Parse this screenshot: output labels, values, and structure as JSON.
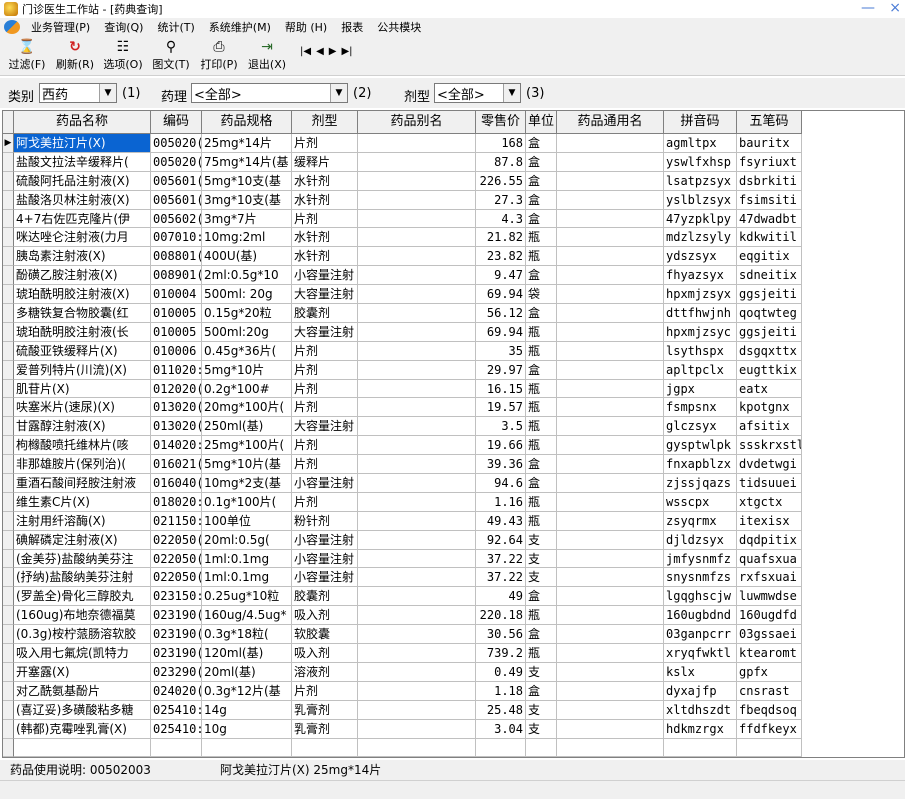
{
  "window": {
    "title": "门诊医生工作站 - [药典查询]",
    "minimize": "—",
    "close": "×"
  },
  "menu": [
    "业务管理(P)",
    "查询(Q)",
    "统计(T)",
    "系统维护(M)",
    "帮助 (H)",
    "报表",
    "公共模块"
  ],
  "toolbar": [
    {
      "label": "过滤(F)",
      "icon": "funnel-icon",
      "glyph": "⌛"
    },
    {
      "label": "刷新(R)",
      "icon": "refresh-icon",
      "glyph": "↻"
    },
    {
      "label": "选项(O)",
      "icon": "options-icon",
      "glyph": "☷"
    },
    {
      "label": "图文(T)",
      "icon": "search-icon",
      "glyph": "⚲"
    },
    {
      "label": "打印(P)",
      "icon": "printer-icon",
      "glyph": "⎙"
    },
    {
      "label": "退出(X)",
      "icon": "exit-icon",
      "glyph": "⇥"
    }
  ],
  "nav": [
    "|◀",
    "◀",
    "▶",
    "▶|"
  ],
  "filters": {
    "category_label": "类别",
    "category_value": "西药",
    "category_hint": "(1)",
    "pharmacology_label": "药理",
    "pharmacology_value": "<全部>",
    "pharmacology_hint": "(2)",
    "dosage_label": "剂型",
    "dosage_value": "<全部>",
    "dosage_hint": "(3)"
  },
  "columns": [
    "药品名称",
    "编码",
    "药品规格",
    "剂型",
    "药品别名",
    "零售价",
    "单位",
    "药品通用名",
    "拼音码",
    "五笔码"
  ],
  "rows": [
    [
      "阿戈美拉汀片(X)",
      "005020(",
      "25mg*14片",
      "片剂",
      "",
      "168",
      "盒",
      "",
      "agmltpx",
      "bauritx"
    ],
    [
      "盐酸文拉法辛缓释片(",
      "005020(",
      "75mg*14片(基",
      "缓释片",
      "",
      "87.8",
      "盒",
      "",
      "yswlfxhsp",
      "fsyriuxt"
    ],
    [
      "硫酸阿托品注射液(X)",
      "005601(",
      "5mg*10支(基",
      "水针剂",
      "",
      "226.55",
      "盒",
      "",
      "lsatpzsyx",
      "dsbrkiti"
    ],
    [
      "盐酸洛贝林注射液(X)",
      "005601(",
      "3mg*10支(基",
      "水针剂",
      "",
      "27.3",
      "盒",
      "",
      "yslblzsyx",
      "fsimsiti"
    ],
    [
      "4+7右佐匹克隆片(伊",
      "005602(",
      "3mg*7片",
      "片剂",
      "",
      "4.3",
      "盒",
      "",
      "47yzpklpy",
      "47dwadbt"
    ],
    [
      "咪达唑仑注射液(力月",
      "007010:",
      "10mg:2ml",
      "水针剂",
      "",
      "21.82",
      "瓶",
      "",
      "mdzlzsyly",
      "kdkwitil"
    ],
    [
      "胰岛素注射液(X)",
      "008801(",
      "400U(基)",
      "水针剂",
      "",
      "23.82",
      "瓶",
      "",
      "ydszsyx",
      "eqgitix"
    ],
    [
      "酚磺乙胺注射液(X)",
      "008901(",
      "2ml:0.5g*10",
      "小容量注射",
      "",
      "9.47",
      "盒",
      "",
      "fhyazsyx",
      "sdneitix"
    ],
    [
      "琥珀酰明胶注射液(X)",
      "010004",
      "500ml: 20g",
      "大容量注射",
      "",
      "69.94",
      "袋",
      "",
      "hpxmjzsyx",
      "ggsjeiti"
    ],
    [
      "多糖铁复合物胶囊(红",
      "010005",
      "0.15g*20粒",
      "胶囊剂",
      "",
      "56.12",
      "盒",
      "",
      "dttfhwjnh",
      "qoqtwteg"
    ],
    [
      "琥珀酰明胶注射液(长",
      "010005",
      "500ml:20g",
      "大容量注射",
      "",
      "69.94",
      "瓶",
      "",
      "hpxmjzsyc",
      "ggsjeiti"
    ],
    [
      "硫酸亚铁缓释片(X)",
      "010006",
      "0.45g*36片(",
      "片剂",
      "",
      "35",
      "瓶",
      "",
      "lsythspx",
      "dsgqxttx"
    ],
    [
      "爱普列特片(川流)(X)",
      "011020:",
      "5mg*10片",
      "片剂",
      "",
      "29.97",
      "盒",
      "",
      "apltpclx",
      "eugttkix"
    ],
    [
      "肌苷片(X)",
      "012020(",
      "0.2g*100#",
      "片剂",
      "",
      "16.15",
      "瓶",
      "",
      "jgpx",
      "eatx"
    ],
    [
      "呋塞米片(速尿)(X)",
      "013020(",
      "20mg*100片(",
      "片剂",
      "",
      "19.57",
      "瓶",
      "",
      "fsmpsnx",
      "kpotgnx"
    ],
    [
      "甘露醇注射液(X)",
      "013020(",
      "250ml(基)",
      "大容量注射",
      "",
      "3.5",
      "瓶",
      "",
      "glczsyx",
      "afsitix"
    ],
    [
      "枸橼酸喷托维林片(咳",
      "014020:",
      "25mg*100片(",
      "片剂",
      "",
      "19.66",
      "瓶",
      "",
      "gysptwlpk",
      "ssskrxstl"
    ],
    [
      "非那雄胺片(保列治)(",
      "016021(",
      "5mg*10片(基",
      "片剂",
      "",
      "39.36",
      "盒",
      "",
      "fnxapblzx",
      "dvdetwgi"
    ],
    [
      "重酒石酸间羟胺注射液",
      "016040(",
      "10mg*2支(基",
      "小容量注射",
      "",
      "94.6",
      "盒",
      "",
      "zjssjqazs",
      "tidsuuei"
    ],
    [
      "维生素C片(X)",
      "018020:",
      "0.1g*100片(",
      "片剂",
      "",
      "1.16",
      "瓶",
      "",
      "wsscpx",
      "xtgctx"
    ],
    [
      "注射用纤溶酶(X)",
      "021150:",
      "100单位",
      "粉针剂",
      "",
      "49.43",
      "瓶",
      "",
      "zsyqrmx",
      "itexisx"
    ],
    [
      "碘解磷定注射液(X)",
      "022050(",
      "20ml:0.5g(",
      "小容量注射",
      "",
      "92.64",
      "支",
      "",
      "djldzsyx",
      "dqdpitix"
    ],
    [
      "(金美芬)盐酸纳美芬注",
      "022050(",
      "1ml:0.1mg",
      "小容量注射",
      "",
      "37.22",
      "支",
      "",
      "jmfysnmfz",
      "quafsxua"
    ],
    [
      "(抒纳)盐酸纳美芬注射",
      "022050(",
      "1ml:0.1mg",
      "小容量注射",
      "",
      "37.22",
      "支",
      "",
      "snysnmfzs",
      "rxfsxuai"
    ],
    [
      "(罗盖全)骨化三醇胶丸",
      "023150:",
      "0.25ug*10粒",
      "胶囊剂",
      "",
      "49",
      "盒",
      "",
      "lgqghscjw",
      "luwmwdse"
    ],
    [
      "(160ug)布地奈德福莫",
      "023190(",
      "160ug/4.5ug*",
      "吸入剂",
      "",
      "220.18",
      "瓶",
      "",
      "160ugbdnd",
      "160ugdfd"
    ],
    [
      "(0.3g)桉柠蒎肠溶软胶",
      "023190(",
      "0.3g*18粒(",
      "软胶囊",
      "",
      "30.56",
      "盒",
      "",
      "03ganpcrr",
      "03gssaei"
    ],
    [
      "吸入用七氟烷(凯特力",
      "023190(",
      "120ml(基)",
      "吸入剂",
      "",
      "739.2",
      "瓶",
      "",
      "xryqfwktl",
      "ktearomt"
    ],
    [
      "开塞露(X)",
      "023290(",
      "20ml(基)",
      "溶液剂",
      "",
      "0.49",
      "支",
      "",
      "kslx",
      "gpfx"
    ],
    [
      "对乙酰氨基酚片",
      "024020(",
      "0.3g*12片(基",
      "片剂",
      "",
      "1.18",
      "盒",
      "",
      "dyxajfp",
      "cnsrast"
    ],
    [
      "(喜辽妥)多磺酸粘多糖",
      "025410:",
      "14g",
      "乳膏剂",
      "",
      "25.48",
      "支",
      "",
      "xltdhszdt",
      "fbeqdsoq"
    ],
    [
      "(韩都)克霉唑乳膏(X)",
      "025410:",
      "10g",
      "乳膏剂",
      "",
      "3.04",
      "支",
      "",
      "hdkmzrgx",
      "ffdfkeyx"
    ]
  ],
  "selected_row": 0,
  "status": {
    "usage_label": "药品使用说明: 00502003",
    "drug_info": "阿戈美拉汀片(X) 25mg*14片"
  }
}
